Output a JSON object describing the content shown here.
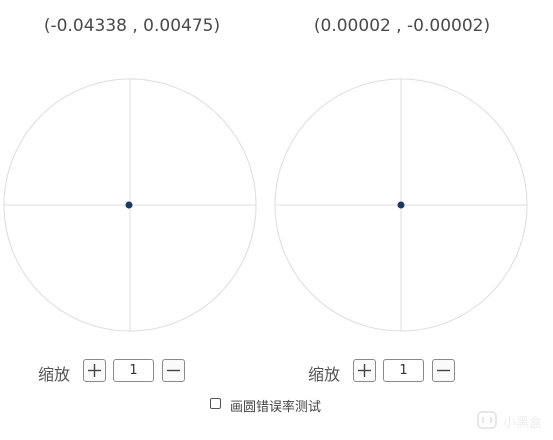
{
  "panels": [
    {
      "coordinate_readout": "(-0.04338 , 0.00475)",
      "zoom_label": "缩放",
      "zoom_value": "1",
      "zoom_in_symbol": "plus-icon",
      "zoom_out_symbol": "minus-icon"
    },
    {
      "coordinate_readout": "(0.00002 , -0.00002)",
      "zoom_label": "缩放",
      "zoom_value": "1",
      "zoom_in_symbol": "plus-icon",
      "zoom_out_symbol": "minus-icon"
    }
  ],
  "error_test": {
    "label": "画圆错误率测试",
    "checked": false
  },
  "watermark": {
    "text": "小黑盒"
  },
  "colors": {
    "circle_stroke": "#dddddd",
    "crosshair": "#dddddd",
    "point": "#1a3a5c",
    "border": "#8a8a8a",
    "text": "#444444"
  }
}
